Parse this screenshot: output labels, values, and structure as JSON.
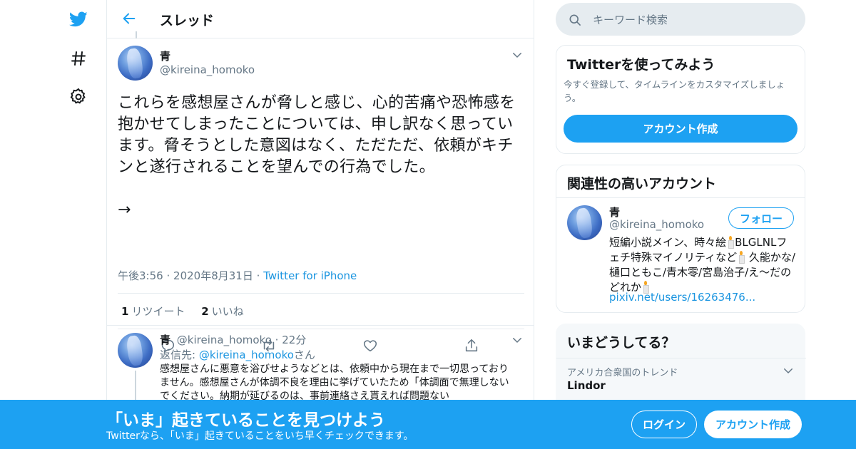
{
  "colors": {
    "accent": "#1da1f2",
    "link": "#1b95e0",
    "muted": "#657786",
    "border": "#e6ecf0"
  },
  "nav": {
    "icons": [
      "twitter-logo-icon",
      "hashtag-icon",
      "gear-icon"
    ]
  },
  "header": {
    "title": "スレッド"
  },
  "main_tweet": {
    "name": "青",
    "handle": "@kireina_homoko",
    "text": "これらを感想屋さんが脅しと感じ、心的苦痛や恐怖感を抱かせてしまったことについては、申し訳なく思っています。脅そうとした意図はなく、ただただ、依頼がキチンと遂行されることを望んでの行為でした。",
    "arrow": "→",
    "time": "午後3:56",
    "date": "2020年8月31日",
    "dot": "·",
    "source": "Twitter for iPhone",
    "retweets_count": "1",
    "retweets_label": "リツイート",
    "likes_count": "2",
    "likes_label": "いいね"
  },
  "reply_tweet": {
    "name": "青",
    "handle": "@kireina_homoko",
    "dot": "·",
    "age": "22分",
    "reply_prefix": "返信先: ",
    "reply_link": "@kireina_homoko",
    "reply_suffix": "さん",
    "text": "感想屋さんに悪意を浴びせようなどとは、依頼中から現在まで一切思っておりません。感想屋さんが体調不良を理由に挙げていたため「体調面で無理しないでください。納期が延びるのは、事前連絡さえ貰えれば問題ない"
  },
  "search": {
    "placeholder": "キーワード検索"
  },
  "signup_card": {
    "title": "Twitterを使ってみよう",
    "desc": "今すぐ登録して、タイムラインをカスタマイズしましょう。",
    "button": "アカウント作成"
  },
  "related_card": {
    "title": "関連性の高いアカウント",
    "name": "青",
    "handle": "@kireina_homoko",
    "follow": "フォロー",
    "bio_1": "短編小説メイン、時々絵",
    "bio_2": "BLGLNLフェチ特殊マイノリティなど",
    "bio_3": " 久能かな/樋口ともこ/青木零/宮島治子/え〜だのどれか",
    "url": "pixiv.net/users/16263476..."
  },
  "trends_card": {
    "title": "いまどうしてる？",
    "location": "アメリカ合衆国のトレンド",
    "trend": "Lindor"
  },
  "banner": {
    "title": "「いま」起きていることを見つけよう",
    "subtitle": "Twitterなら、「いま」起きていることをいち早くチェックできます。",
    "login": "ログイン",
    "signup": "アカウント作成"
  }
}
